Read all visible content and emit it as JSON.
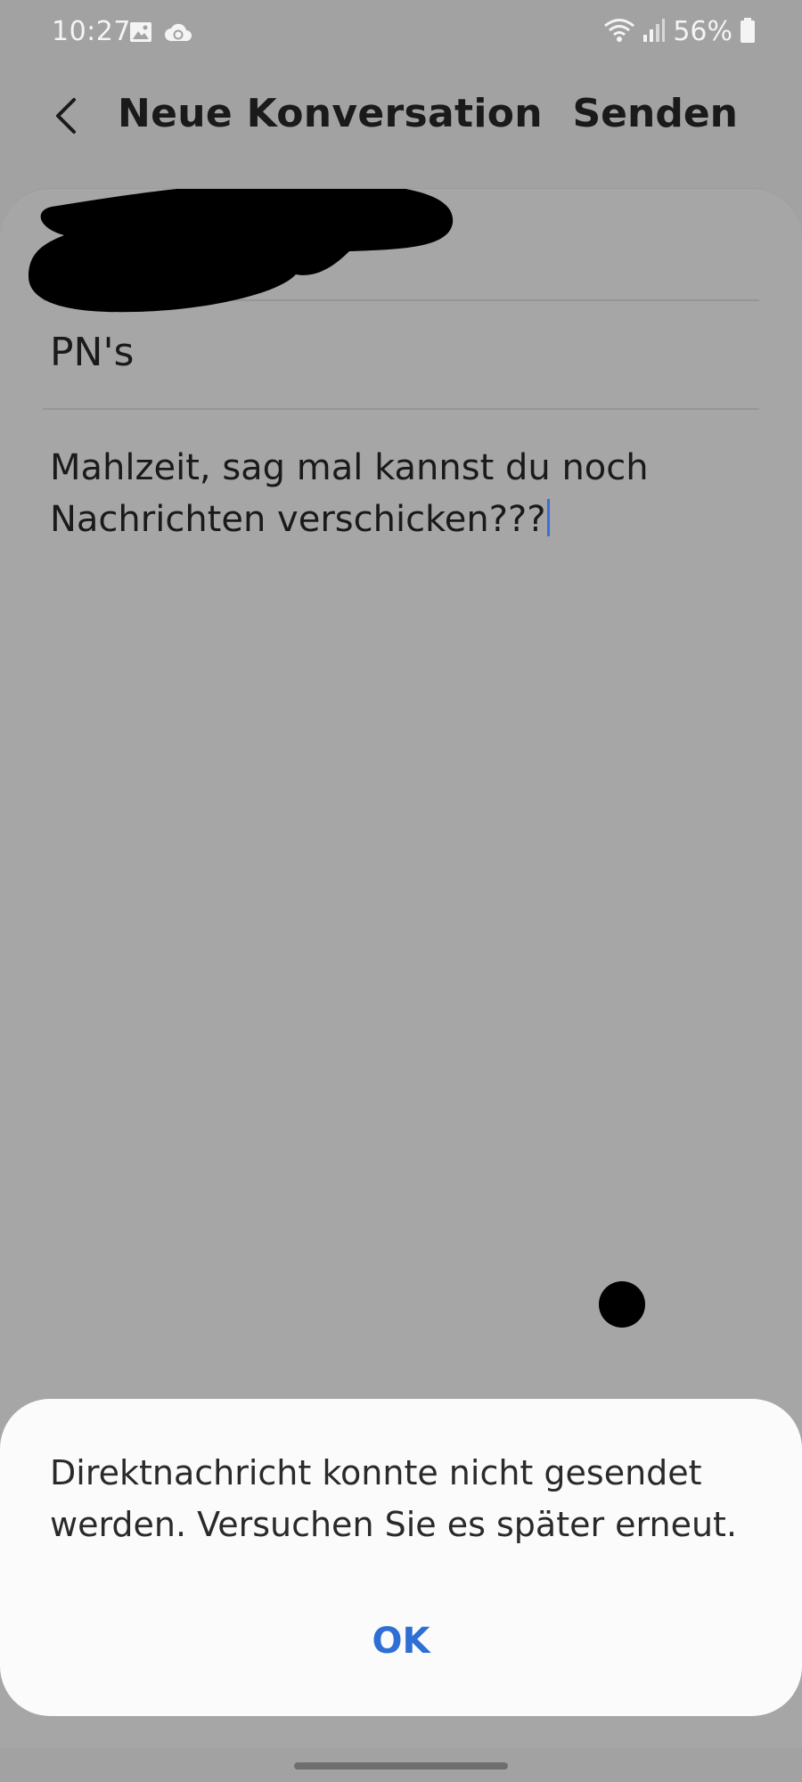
{
  "status_bar": {
    "time": "10:27",
    "battery": "56%",
    "icons": [
      "gallery-icon",
      "cloud-sync-icon",
      "wifi-icon",
      "signal-icon",
      "battery-icon"
    ]
  },
  "app_bar": {
    "back_icon": "chevron-left-icon",
    "title": "Neue Konversation",
    "send_label": "Senden"
  },
  "compose": {
    "recipient": "",
    "subject": "PN's",
    "message": "Mahlzeit, sag mal kannst du noch Nachrichten verschicken???"
  },
  "dialog": {
    "message": "Direktnachricht konnte nicht gesendet werden. Versuchen Sie es später erneut.",
    "ok_label": "OK"
  },
  "colors": {
    "accent": "#2e6fd6",
    "background": "#a2a2a2",
    "dialog_background": "#fbfbfb"
  }
}
